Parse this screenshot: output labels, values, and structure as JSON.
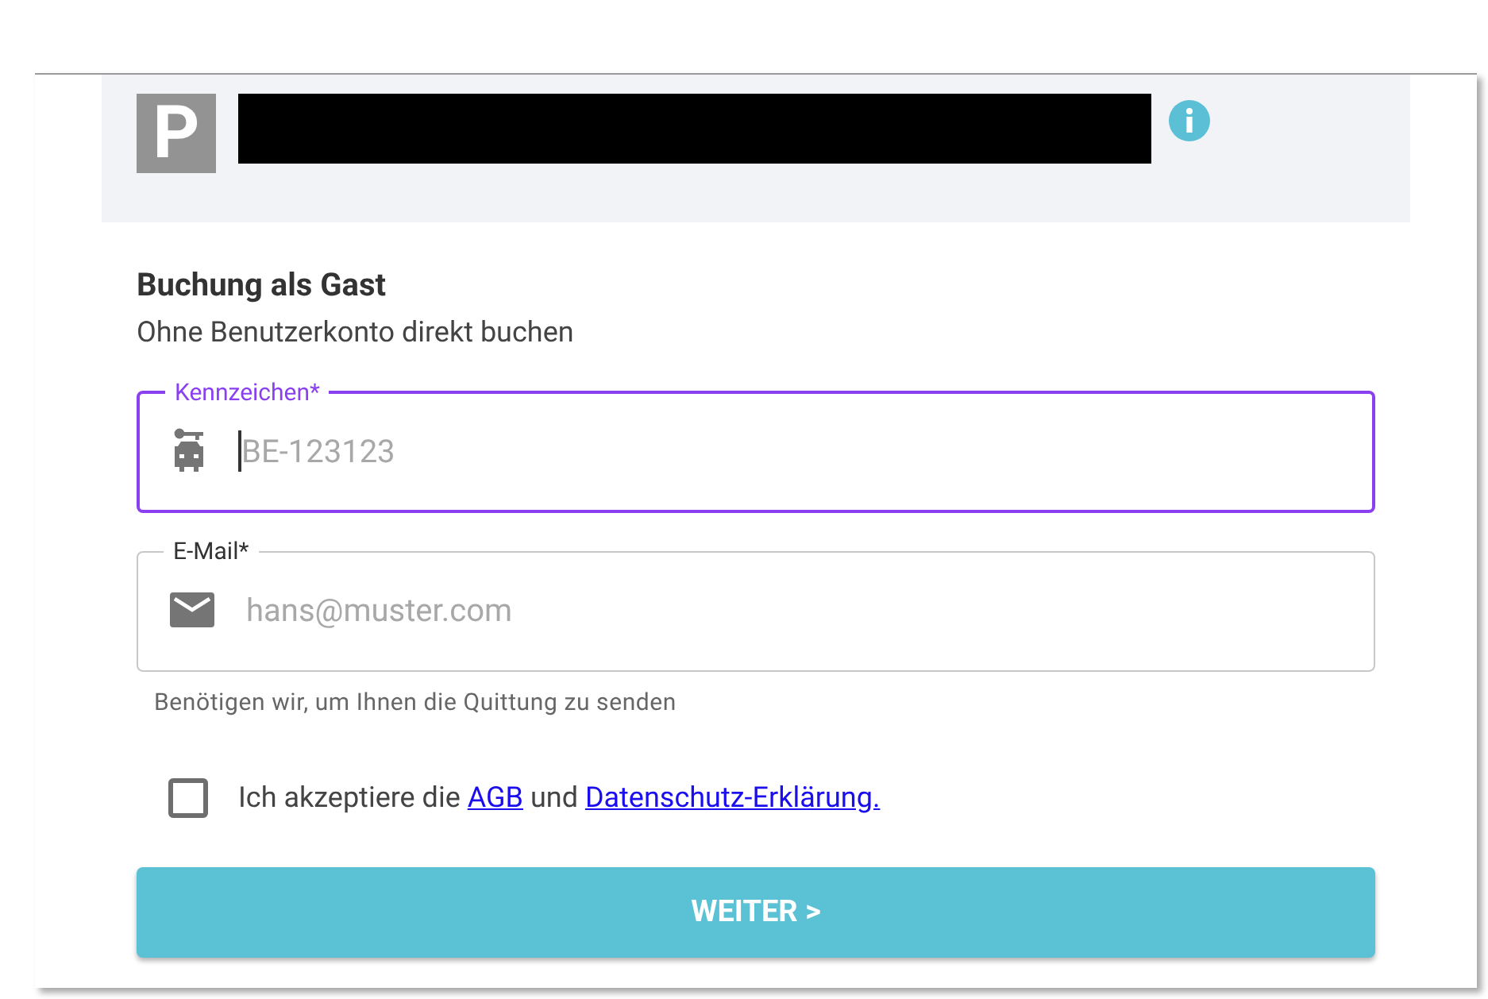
{
  "header": {
    "logo": "P"
  },
  "section": {
    "title": "Buchung als Gast",
    "subtitle": "Ohne Benutzerkonto direkt buchen"
  },
  "fields": [
    {
      "kind": "plate",
      "label": "Kennzeichen*",
      "placeholder": "BE-123123",
      "focused": true
    },
    {
      "kind": "email",
      "label": "E-Mail*",
      "placeholder": "hans@muster.com",
      "focused": false,
      "helper": "Benötigen wir, um Ihnen die Quittung zu senden"
    }
  ],
  "consent": {
    "checked": false,
    "text_before": "Ich akzeptiere die",
    "link_terms": "AGB",
    "text_middle": "und",
    "link_privacy": "Datenschutz-Erklärung."
  },
  "button": {
    "label": "WEITER >"
  }
}
